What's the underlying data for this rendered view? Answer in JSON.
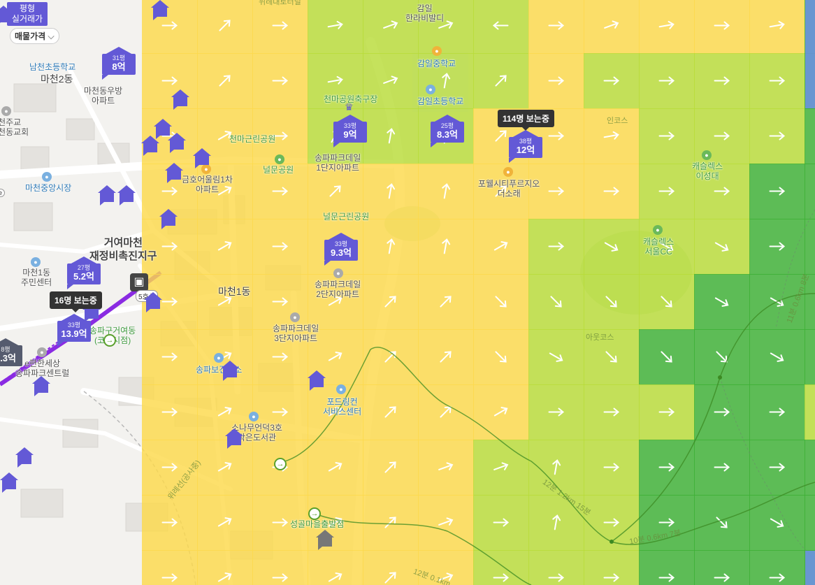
{
  "controls": {
    "mode_title_line1": "평형",
    "mode_title_line2": "실거래가",
    "price_select": "매물가격",
    "chevron_icon": "chevron-down-icon"
  },
  "colors": {
    "accent": "#6359d6",
    "tile_yellow": "#fdd94c",
    "tile_lime": "#b8dc38",
    "tile_green": "#3cb034",
    "tooltip": "#333333",
    "line_purple": "#8a2be2"
  },
  "wind_grid": {
    "cols": 15,
    "rows": 11,
    "tile_colors": [
      [
        "Y",
        "Y",
        "Y",
        "L",
        "L",
        "L",
        "L",
        "Y",
        "Y",
        "Y",
        "Y",
        "Y",
        "G",
        "G",
        "G"
      ],
      [
        "Y",
        "Y",
        "Y",
        "L",
        "L",
        "L",
        "L",
        "Y",
        "L",
        "L",
        "L",
        "L",
        "G",
        "G",
        "G"
      ],
      [
        "Y",
        "Y",
        "Y",
        "L",
        "L",
        "L",
        "Y",
        "Y",
        "Y",
        "L",
        "L",
        "L",
        "G",
        "G",
        "G"
      ],
      [
        "Y",
        "Y",
        "Y",
        "Y",
        "Y",
        "Y",
        "Y",
        "Y",
        "Y",
        "L",
        "L",
        "G",
        "G",
        "G",
        "G"
      ],
      [
        "Y",
        "Y",
        "Y",
        "Y",
        "Y",
        "Y",
        "Y",
        "L",
        "L",
        "L",
        "L",
        "G",
        "G",
        "G",
        "G"
      ],
      [
        "Y",
        "Y",
        "Y",
        "Y",
        "Y",
        "Y",
        "Y",
        "L",
        "L",
        "L",
        "G",
        "G",
        "G",
        "G",
        "G"
      ],
      [
        "Y",
        "Y",
        "Y",
        "Y",
        "Y",
        "Y",
        "Y",
        "L",
        "L",
        "G",
        "G",
        "G",
        "G",
        "G",
        "G"
      ],
      [
        "Y",
        "Y",
        "Y",
        "Y",
        "Y",
        "Y",
        "Y",
        "L",
        "L",
        "L",
        "G",
        "G",
        "L",
        "G",
        "G"
      ],
      [
        "Y",
        "Y",
        "Y",
        "Y",
        "Y",
        "Y",
        "L",
        "L",
        "L",
        "G",
        "G",
        "G",
        "G",
        "G",
        "G"
      ],
      [
        "Y",
        "Y",
        "Y",
        "Y",
        "Y",
        "Y",
        "L",
        "L",
        "L",
        "G",
        "G",
        "G",
        "G",
        "L",
        "G"
      ],
      [
        "Y",
        "Y",
        "Y",
        "Y",
        "Y",
        "Y",
        "L",
        "L",
        "L",
        "G",
        "G",
        "G",
        "G",
        "G",
        "G"
      ]
    ],
    "arrow_angles_deg": [
      [
        0,
        -45,
        0,
        -10,
        -20,
        -20,
        180,
        0,
        -20,
        -10,
        0,
        -10,
        20,
        30,
        45
      ],
      [
        0,
        -45,
        0,
        -10,
        -20,
        -80,
        -45,
        0,
        0,
        0,
        0,
        0,
        15,
        20,
        20
      ],
      [
        0,
        -30,
        0,
        -60,
        -80,
        -80,
        -45,
        0,
        -10,
        0,
        0,
        0,
        10,
        0,
        10
      ],
      [
        0,
        -30,
        0,
        -45,
        -80,
        -80,
        -45,
        0,
        0,
        0,
        0,
        0,
        0,
        0,
        0
      ],
      [
        0,
        -30,
        0,
        -30,
        -80,
        -80,
        -30,
        0,
        30,
        30,
        30,
        0,
        0,
        0,
        0
      ],
      [
        0,
        -30,
        0,
        -30,
        -45,
        -45,
        45,
        45,
        45,
        45,
        30,
        30,
        30,
        30,
        30
      ],
      [
        0,
        -30,
        0,
        -30,
        -45,
        -45,
        45,
        30,
        45,
        45,
        45,
        30,
        30,
        30,
        30
      ],
      [
        0,
        -30,
        0,
        -30,
        -45,
        -45,
        -30,
        0,
        0,
        0,
        0,
        0,
        0,
        0,
        0
      ],
      [
        0,
        -30,
        0,
        -30,
        -45,
        -20,
        -20,
        -80,
        0,
        0,
        0,
        0,
        0,
        0,
        0
      ],
      [
        0,
        -30,
        0,
        -30,
        -45,
        -20,
        0,
        -80,
        0,
        0,
        45,
        30,
        30,
        30,
        30
      ],
      [
        0,
        -30,
        0,
        -30,
        -45,
        -20,
        0,
        0,
        0,
        0,
        0,
        0,
        0,
        0,
        0
      ]
    ]
  },
  "listings": [
    {
      "size": "31평",
      "price": "8억"
    },
    {
      "size": "33평",
      "price": "9억"
    },
    {
      "size": "25평",
      "price": "8.3억"
    },
    {
      "size": "38평",
      "price": "12억"
    },
    {
      "size": "33평",
      "price": "9.3억"
    },
    {
      "size": "27평",
      "price": "5.2억"
    },
    {
      "size": "33평",
      "price": "13.9억"
    },
    {
      "size": "8평",
      "price": "3.3억"
    }
  ],
  "viewer_tips": {
    "tip1": "114명 보는중",
    "tip2": "16명 보는중"
  },
  "labels": {
    "area_top": "위례대로터널",
    "gamil": "감일\n한라비발디",
    "namcheon_school": "남천초등학교",
    "macheon2": "마천2동",
    "macheon_woobang": "마천동우방\n아파트",
    "gamil_middle": "감일중학교",
    "gamil_elem": "감일초등학교",
    "cheonma_fight": "천마공원축구장",
    "cheonma_park": "천마근린공원",
    "songpa_1": "송파파크데일\n1단지아파트",
    "neolmun_park": "널문공원",
    "geumho": "금호어울림1차\n아파트",
    "macheon_market": "마천중앙시장",
    "church": "천주교\n마천동교회",
    "poretel": "포웰시티푸르지오\n더소래",
    "cas": "캐슬렉스\n이성대",
    "cas2": "캐슬렉스\n서울CC",
    "neolmun_big": "널문근린공원",
    "geoyeo": "거여마천\n재정비촉진지구",
    "macheon1_center": "마천1동\n주민센터",
    "macheon1": "마천1동",
    "songpa_2": "송파파크데일\n2단지아파트",
    "songpa_3": "송파파크데일\n3단지아파트",
    "geoyeo_station": "송파구거여동\n(코스시점)",
    "ehan": "e편한세상\n송파파크센트럴",
    "songpa_bogun": "송파보건지소",
    "podring": "포드링컨\n서비스센터",
    "library": "소나무언덕3호\n작은도서관",
    "seonggol": "성골마을출발점",
    "wirye_road": "위례선(공사중)",
    "subway_line": "5호선",
    "incourse": "인코스",
    "outcourse": "아웃코스",
    "trail1": "12분 1.2km 15분",
    "trail2": "10분 0.6km 7분",
    "trail3": "11분 0.6km 8분",
    "trail4": "12분 0.1km",
    "e_label": "e"
  }
}
